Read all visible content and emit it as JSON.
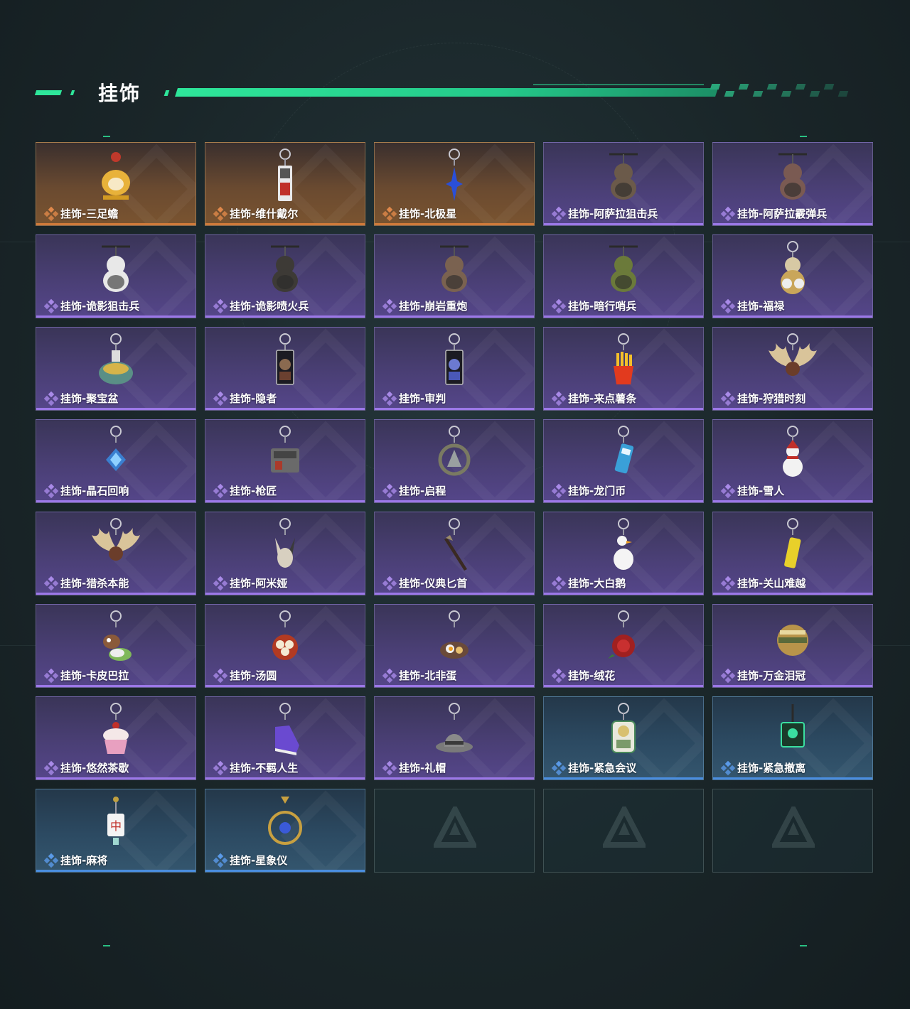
{
  "section": {
    "title": "挂饰"
  },
  "colors": {
    "accent": "#2ee69a",
    "orange": "#d07a3a",
    "purple": "#9c78e8",
    "blue": "#4a8ee0"
  },
  "items": [
    {
      "label": "挂饰-三足蟾",
      "rarity": "orange",
      "icon": "golden-toad-charm-icon"
    },
    {
      "label": "挂饰-维什戴尔",
      "rarity": "orange",
      "icon": "red-card-charm-icon"
    },
    {
      "label": "挂饰-北极星",
      "rarity": "orange",
      "icon": "blue-star-charm-icon"
    },
    {
      "label": "挂饰-阿萨拉狙击兵",
      "rarity": "purple",
      "icon": "sniper-figure-charm-icon"
    },
    {
      "label": "挂饰-阿萨拉霰弹兵",
      "rarity": "purple",
      "icon": "shotgunner-figure-charm-icon"
    },
    {
      "label": "挂饰-诡影狙击兵",
      "rarity": "purple",
      "icon": "ghost-sniper-charm-icon"
    },
    {
      "label": "挂饰-诡影喷火兵",
      "rarity": "purple",
      "icon": "ghost-flamethrower-charm-icon"
    },
    {
      "label": "挂饰-崩岩重炮",
      "rarity": "purple",
      "icon": "heavy-gunner-charm-icon"
    },
    {
      "label": "挂饰-暗行哨兵",
      "rarity": "purple",
      "icon": "sentry-charm-icon"
    },
    {
      "label": "挂饰-福禄",
      "rarity": "purple",
      "icon": "gourd-charm-icon"
    },
    {
      "label": "挂饰-聚宝盆",
      "rarity": "purple",
      "icon": "treasure-bowl-charm-icon"
    },
    {
      "label": "挂饰-隐者",
      "rarity": "purple",
      "icon": "hermit-card-charm-icon"
    },
    {
      "label": "挂饰-审判",
      "rarity": "purple",
      "icon": "judgement-card-charm-icon"
    },
    {
      "label": "挂饰-来点薯条",
      "rarity": "purple",
      "icon": "fries-charm-icon"
    },
    {
      "label": "挂饰-狩猎时刻",
      "rarity": "purple",
      "icon": "antler-charm-icon"
    },
    {
      "label": "挂饰-晶石回响",
      "rarity": "purple",
      "icon": "crystal-charm-icon"
    },
    {
      "label": "挂饰-枪匠",
      "rarity": "purple",
      "icon": "gunsmith-charm-icon"
    },
    {
      "label": "挂饰-启程",
      "rarity": "purple",
      "icon": "emblem-ring-charm-icon"
    },
    {
      "label": "挂饰-龙门币",
      "rarity": "purple",
      "icon": "coin-card-charm-icon"
    },
    {
      "label": "挂饰-雪人",
      "rarity": "purple",
      "icon": "snowman-charm-icon"
    },
    {
      "label": "挂饰-猎杀本能",
      "rarity": "purple",
      "icon": "antler-charm-icon"
    },
    {
      "label": "挂饰-阿米娅",
      "rarity": "purple",
      "icon": "bunny-charm-icon"
    },
    {
      "label": "挂饰-仪典匕首",
      "rarity": "purple",
      "icon": "dagger-charm-icon"
    },
    {
      "label": "挂饰-大白鹅",
      "rarity": "purple",
      "icon": "goose-charm-icon"
    },
    {
      "label": "挂饰-关山难越",
      "rarity": "purple",
      "icon": "gold-bar-charm-icon"
    },
    {
      "label": "挂饰-卡皮巴拉",
      "rarity": "purple",
      "icon": "capybara-charm-icon"
    },
    {
      "label": "挂饰-汤圆",
      "rarity": "purple",
      "icon": "dumpling-bowl-charm-icon"
    },
    {
      "label": "挂饰-北非蛋",
      "rarity": "purple",
      "icon": "shakshuka-charm-icon"
    },
    {
      "label": "挂饰-绒花",
      "rarity": "purple",
      "icon": "rose-charm-icon"
    },
    {
      "label": "挂饰-万金泪冠",
      "rarity": "purple",
      "icon": "crown-charm-icon"
    },
    {
      "label": "挂饰-悠然茶歇",
      "rarity": "purple",
      "icon": "cupcake-charm-icon"
    },
    {
      "label": "挂饰-不羁人生",
      "rarity": "purple",
      "icon": "sneaker-charm-icon"
    },
    {
      "label": "挂饰-礼帽",
      "rarity": "purple",
      "icon": "hat-charm-icon"
    },
    {
      "label": "挂饰-紧急会议",
      "rarity": "blue",
      "icon": "astronaut-charm-icon"
    },
    {
      "label": "挂饰-紧急撤离",
      "rarity": "blue",
      "icon": "skull-tag-charm-icon"
    },
    {
      "label": "挂饰-麻将",
      "rarity": "blue",
      "icon": "mahjong-charm-icon"
    },
    {
      "label": "挂饰-星象仪",
      "rarity": "blue",
      "icon": "astrolabe-charm-icon"
    },
    {
      "label": "",
      "rarity": "empty",
      "icon": "empty-slot-logo-icon"
    },
    {
      "label": "",
      "rarity": "empty",
      "icon": "empty-slot-logo-icon"
    },
    {
      "label": "",
      "rarity": "empty",
      "icon": "empty-slot-logo-icon"
    }
  ]
}
